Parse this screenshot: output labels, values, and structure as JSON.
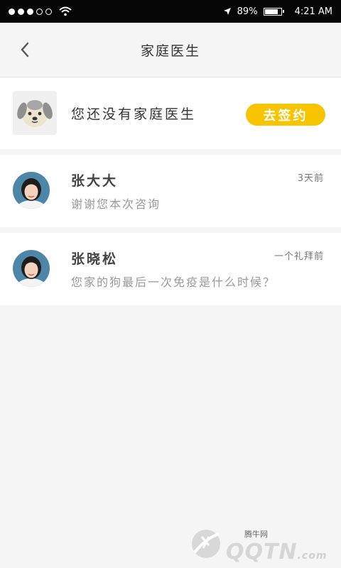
{
  "status_bar": {
    "signal_dots": [
      true,
      true,
      true,
      false,
      false
    ],
    "battery_percent": "89%",
    "battery_level": 0.89,
    "time": "4:21 AM",
    "icons": [
      "wifi-icon",
      "location-arrow-icon",
      "battery-icon"
    ]
  },
  "nav": {
    "title": "家庭医生",
    "back_icon": "chevron-left-icon"
  },
  "sign_card": {
    "text": "您还没有家庭医生",
    "button_label": "去签约",
    "avatar_icon": "dog-face-icon",
    "accent_color": "#f8c400"
  },
  "chats": [
    {
      "name": "张大大",
      "message": "谢谢您本次咨询",
      "time": "3天前"
    },
    {
      "name": "张晓松",
      "message": "您家的狗最后一次免疫是什么时候？",
      "time": "一个礼拜前"
    }
  ],
  "watermark": {
    "site_name": "腾牛网",
    "brand": "QQTN",
    "suffix": ".com"
  }
}
